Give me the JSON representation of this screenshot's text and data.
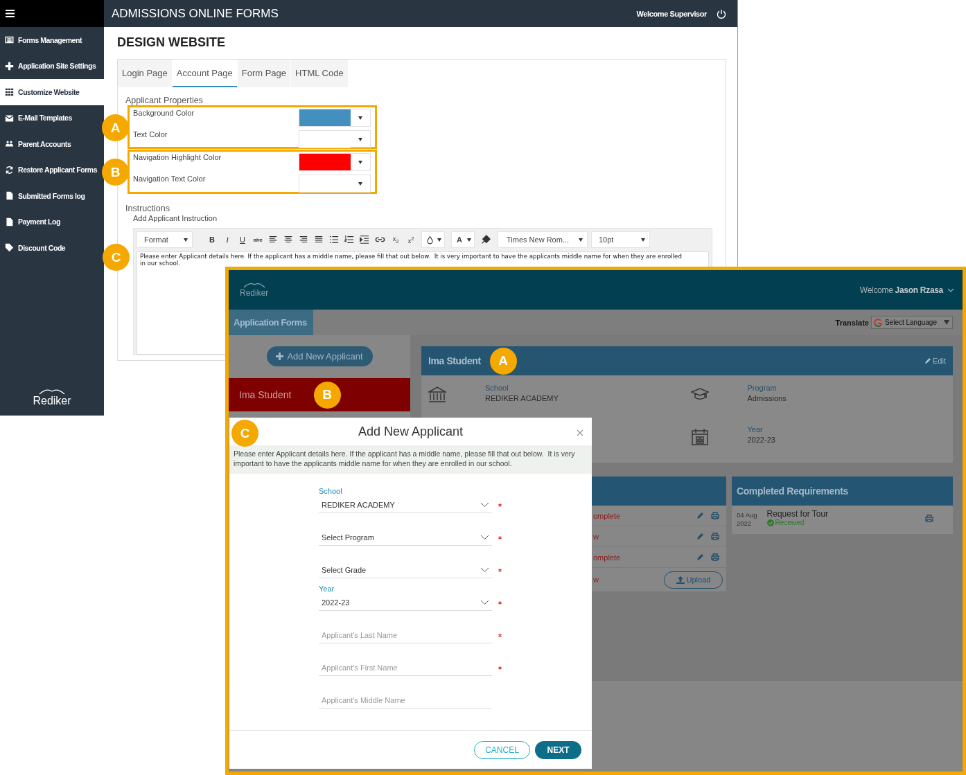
{
  "admin": {
    "title": "ADMISSIONS ONLINE FORMS",
    "welcome": "Welcome Supervisor",
    "sidebar": [
      {
        "label": "Forms Management",
        "selected": false
      },
      {
        "label": "Application Site Settings",
        "selected": false
      },
      {
        "label": "Customize Website",
        "selected": true
      },
      {
        "label": "E-Mail Templates",
        "selected": false
      },
      {
        "label": "Parent Accounts",
        "selected": false
      },
      {
        "label": "Restore Applicant Forms",
        "selected": false
      },
      {
        "label": "Submitted Forms log",
        "selected": false
      },
      {
        "label": "Payment Log",
        "selected": false
      },
      {
        "label": "Discount Code",
        "selected": false
      }
    ],
    "logo": "Rediker",
    "page_title": "DESIGN WEBSITE",
    "tabs": [
      {
        "label": "Login Page",
        "selected": false
      },
      {
        "label": "Account Page",
        "selected": true
      },
      {
        "label": "Form Page",
        "selected": false
      },
      {
        "label": "HTML Code",
        "selected": false
      }
    ],
    "properties_title": "Applicant Properties",
    "groups": [
      {
        "callout": "A",
        "rows": [
          {
            "label": "Background Color",
            "color": "#428fc0"
          },
          {
            "label": "Text Color"
          }
        ]
      },
      {
        "callout": "B",
        "rows": [
          {
            "label": "Navigation Highlight Color",
            "color": "#ff0000"
          },
          {
            "label": "Navigation Text Color"
          }
        ]
      }
    ],
    "instructions_title": "Instructions",
    "instructions_subtitle": "Add Applicant Instruction",
    "editor": {
      "format": "Format",
      "bold": "B",
      "italic": "I",
      "underline": "U",
      "strike": "abc",
      "subscript": "x$_{2}$",
      "superscript": "x$^{2}$",
      "text_color": "A",
      "font": "Times New Rom...",
      "size": "10pt",
      "callout": "C",
      "text": "Please enter Applicant details here. If the applicant has a middle name, please fill that out below.  It is very important to have the applicants middle name for when they are enrolled in our school."
    }
  },
  "portal": {
    "logo": "Rediker",
    "welcome": "Welcome **Jason Rzasa**",
    "nav_tab": "Application Forms",
    "translate": "Translate",
    "language": "Select Language",
    "add_button": "Add New Applicant",
    "students": [
      {
        "name": "Ima Student",
        "selected": true,
        "callout": "B"
      }
    ],
    "card": {
      "name": "Ima Student",
      "callout": "A",
      "edit": "Edit",
      "info": [
        {
          "label": "School",
          "value": "REDIKER ACADEMY"
        },
        {
          "label": "Program",
          "value": "Admissions"
        },
        {
          "label": "Year",
          "value": "2022-23"
        }
      ]
    },
    "requirements": [
      {
        "kind": "form",
        "status": "omplete"
      },
      {
        "kind": "form",
        "status": "w"
      },
      {
        "kind": "form",
        "status": "omplete"
      },
      {
        "kind": "upload",
        "status": "w",
        "button": "Upload"
      }
    ],
    "completed": {
      "title": "Completed Requirements",
      "items": [
        {
          "date": "04 Aug",
          "year": "2022",
          "name": "Request for Tour",
          "status": "Received"
        }
      ]
    },
    "modal": {
      "callout": "C",
      "title": "Add New Applicant",
      "instructions": "Please enter Applicant details here. If the applicant has a middle name, please fill that out below.  It is very important to have the applicants middle name for when they are enrolled in our school.",
      "fields": [
        {
          "kind": "select",
          "label": "School",
          "value": "REDIKER ACADEMY",
          "required": true
        },
        {
          "kind": "select",
          "value": "Select Program",
          "required": true
        },
        {
          "kind": "select",
          "value": "Select Grade",
          "required": true
        },
        {
          "kind": "select",
          "label": "Year",
          "value": "2022-23",
          "required": true
        },
        {
          "kind": "input",
          "placeholder": "Applicant's Last Name",
          "required": true
        },
        {
          "kind": "input",
          "placeholder": "Applicant's First Name",
          "required": true
        },
        {
          "kind": "input",
          "placeholder": "Applicant's Middle Name",
          "required": false
        }
      ],
      "cancel": "CANCEL",
      "next": "NEXT"
    }
  }
}
